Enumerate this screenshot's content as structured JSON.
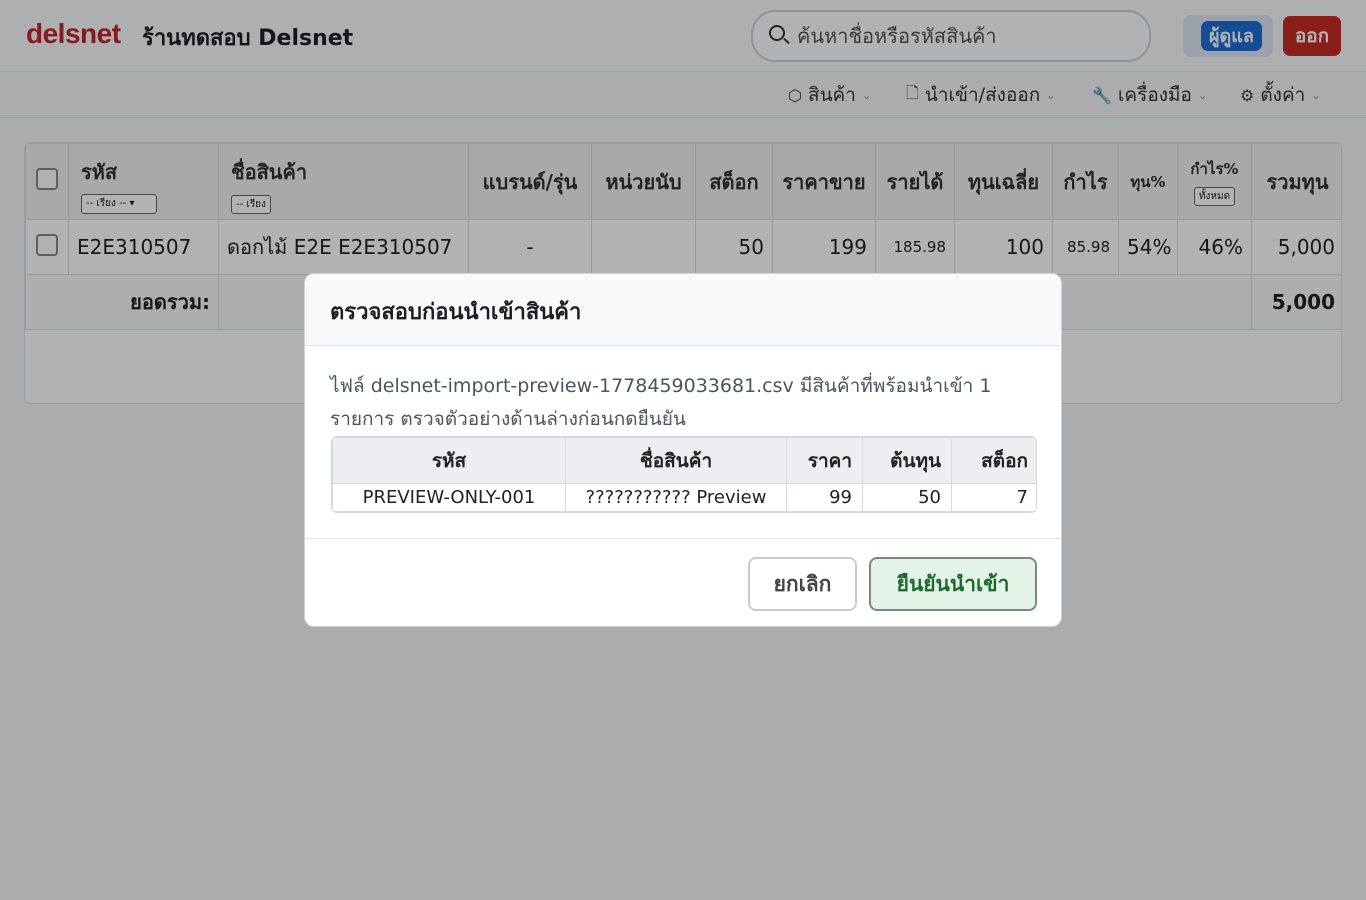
{
  "header": {
    "logo": "delsnet",
    "shop_name": "ร้านทดสอบ Delsnet",
    "search_placeholder": "ค้นหาชื่อหรือรหัสสินค้า",
    "admin_label": "ผู้ดูแล",
    "logout_label": "ออก"
  },
  "nav": [
    {
      "label": "สินค้า",
      "icon": "box-icon"
    },
    {
      "label": "นำเข้า/ส่งออก",
      "icon": "file-icon"
    },
    {
      "label": "เครื่องมือ",
      "icon": "wrench-icon"
    },
    {
      "label": "ตั้งค่า",
      "icon": "gear-icon"
    }
  ],
  "table": {
    "columns": [
      "รหัส",
      "ชื่อสินค้า",
      "แบรนด์/รุ่น",
      "หน่วยนับ",
      "สต็อก",
      "ราคาขาย",
      "รายได้",
      "ทุนเฉลี่ย",
      "กำไร",
      "ทุน%",
      "กำไร%",
      "รวมทุน"
    ],
    "sort_select": "-- เรียง --",
    "sort_btn": "-- เรียง",
    "profit_filter": "ทั้งหมด",
    "rows": [
      {
        "code": "E2E310507",
        "name": "ดอกไม้ E2E E2E310507",
        "brand": "-",
        "unit": "",
        "stock": "50",
        "price": "199",
        "revenue": "185.98",
        "avg_cost": "100",
        "profit": "85.98",
        "cost_pct": "54%",
        "profit_pct": "46%",
        "total_cost": "5,000"
      }
    ],
    "total_label": "ยอดรวม:",
    "total_value": "5,000"
  },
  "modal": {
    "title": "ตรวจสอบก่อนนำเข้าสินค้า",
    "description": "ไฟล์ delsnet-import-preview-1778459033681.csv มีสินค้าที่พร้อมนำเข้า 1 รายการ ตรวจตัวอย่างด้านล่างก่อนกดยืนยัน",
    "preview_columns": [
      "รหัส",
      "ชื่อสินค้า",
      "ราคา",
      "ต้นทุน",
      "สต็อก"
    ],
    "preview_rows": [
      {
        "code": "PREVIEW-ONLY-001",
        "name": "??????????? Preview",
        "price": "99",
        "cost": "50",
        "stock": "7"
      }
    ],
    "cancel_label": "ยกเลิก",
    "confirm_label": "ยืนยันนำเข้า"
  }
}
